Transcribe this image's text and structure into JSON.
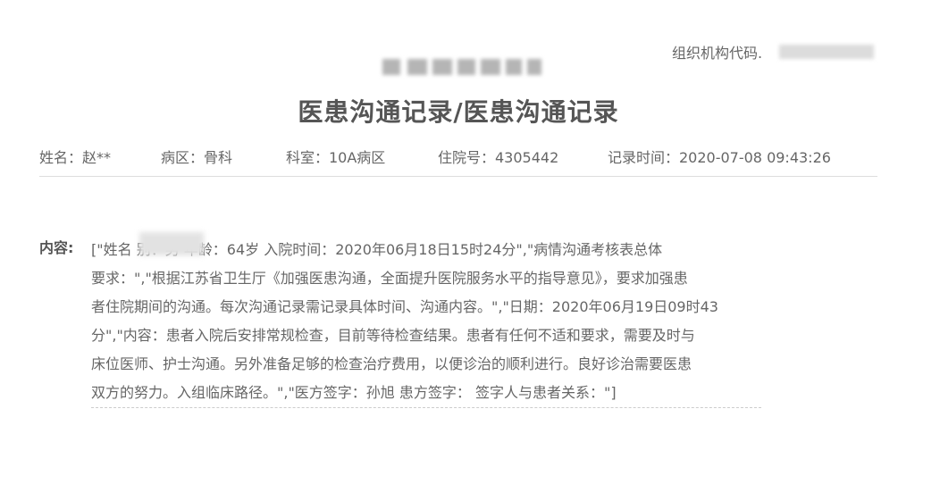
{
  "header": {
    "org_code_label": "组织机构代码.",
    "title": "医患沟通记录/医患沟通记录"
  },
  "patient_info": {
    "name": "姓名：赵**",
    "ward": "病区：骨科",
    "department": "科室：10A病区",
    "admission_no": "住院号：4305442",
    "record_time": "记录时间：2020-07-08 09:43:26"
  },
  "content": {
    "label": "内容:",
    "lines": [
      "[\"姓名                  别：男 年龄：64岁 入院时间：2020年06月18日15时24分\",\"病情沟通考核表总体",
      "要求：\",\"根据江苏省卫生厅《加强医患沟通，全面提升医院服务水平的指导意见》，要求加强患",
      "者住院期间的沟通。每次沟通记录需记录具体时间、沟通内容。\",\"日期：2020年06月19日09时43",
      "分\",\"内容：患者入院后安排常规检查，目前等待检查结果。患者有任何不适和要求，需要及时与",
      "床位医师、护士沟通。另外准备足够的检查治疗费用，以便诊治的顺利进行。良好诊治需要医患",
      "双方的努力。入组临床路径。\",\"医方签字：孙旭 患方签字：  签字人与患者关系：\"]"
    ]
  }
}
